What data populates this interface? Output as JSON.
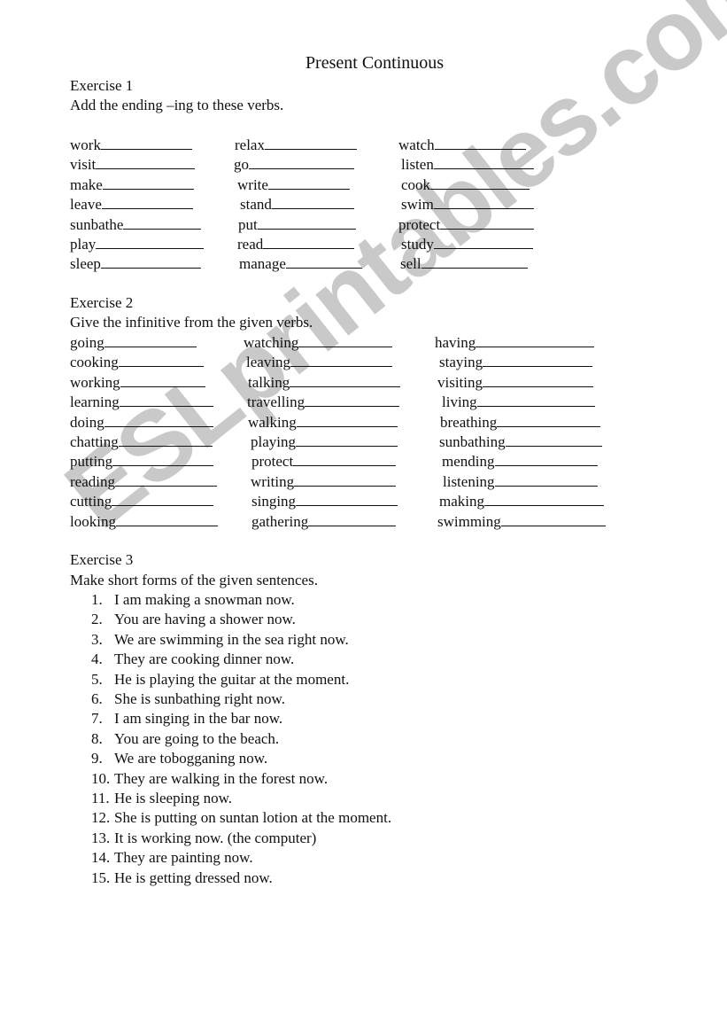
{
  "watermark": "ESLprintables.com",
  "title": "Present Continuous",
  "exercise1": {
    "heading": "Exercise 1",
    "instruction": "Add the ending –ing to these verbs.",
    "columns": [
      [
        "work",
        "visit",
        "make",
        "leave",
        "sunbathe",
        "play",
        "sleep"
      ],
      [
        "relax",
        "go",
        "write",
        "stand",
        "put",
        "read",
        "manage"
      ],
      [
        "watch",
        "listen",
        "cook",
        "swim",
        "protect",
        "study",
        "sell"
      ]
    ]
  },
  "exercise2": {
    "heading": "Exercise 2",
    "instruction": "Give the infinitive from the given verbs.",
    "columns": [
      [
        "going",
        "cooking",
        "working",
        "learning",
        "doing",
        "chatting",
        "putting",
        "reading",
        "cutting",
        "looking"
      ],
      [
        "watching",
        "leaving",
        "talking",
        "travelling",
        "walking",
        "playing",
        "protect",
        "writing",
        "singing",
        "gathering"
      ],
      [
        "having",
        "staying",
        "visiting",
        "living",
        "breathing",
        "sunbathing",
        "mending",
        "listening",
        "making",
        "swimming"
      ]
    ]
  },
  "exercise3": {
    "heading": "Exercise 3",
    "instruction": "Make short forms of the given sentences.",
    "sentences": [
      "I am making a snowman now.",
      "You are having a shower now.",
      "We are swimming in the sea right now.",
      "They are cooking dinner now.",
      "He is playing the guitar at the moment.",
      "She is sunbathing right now.",
      "I am singing in the bar now.",
      "You are going to the beach.",
      "We are tobogganing now.",
      "They are walking in the forest now.",
      "He is sleeping now.",
      "She is putting on suntan lotion at the moment.",
      "It is working now. (the computer)",
      "They are painting now.",
      "He is getting dressed now."
    ]
  }
}
